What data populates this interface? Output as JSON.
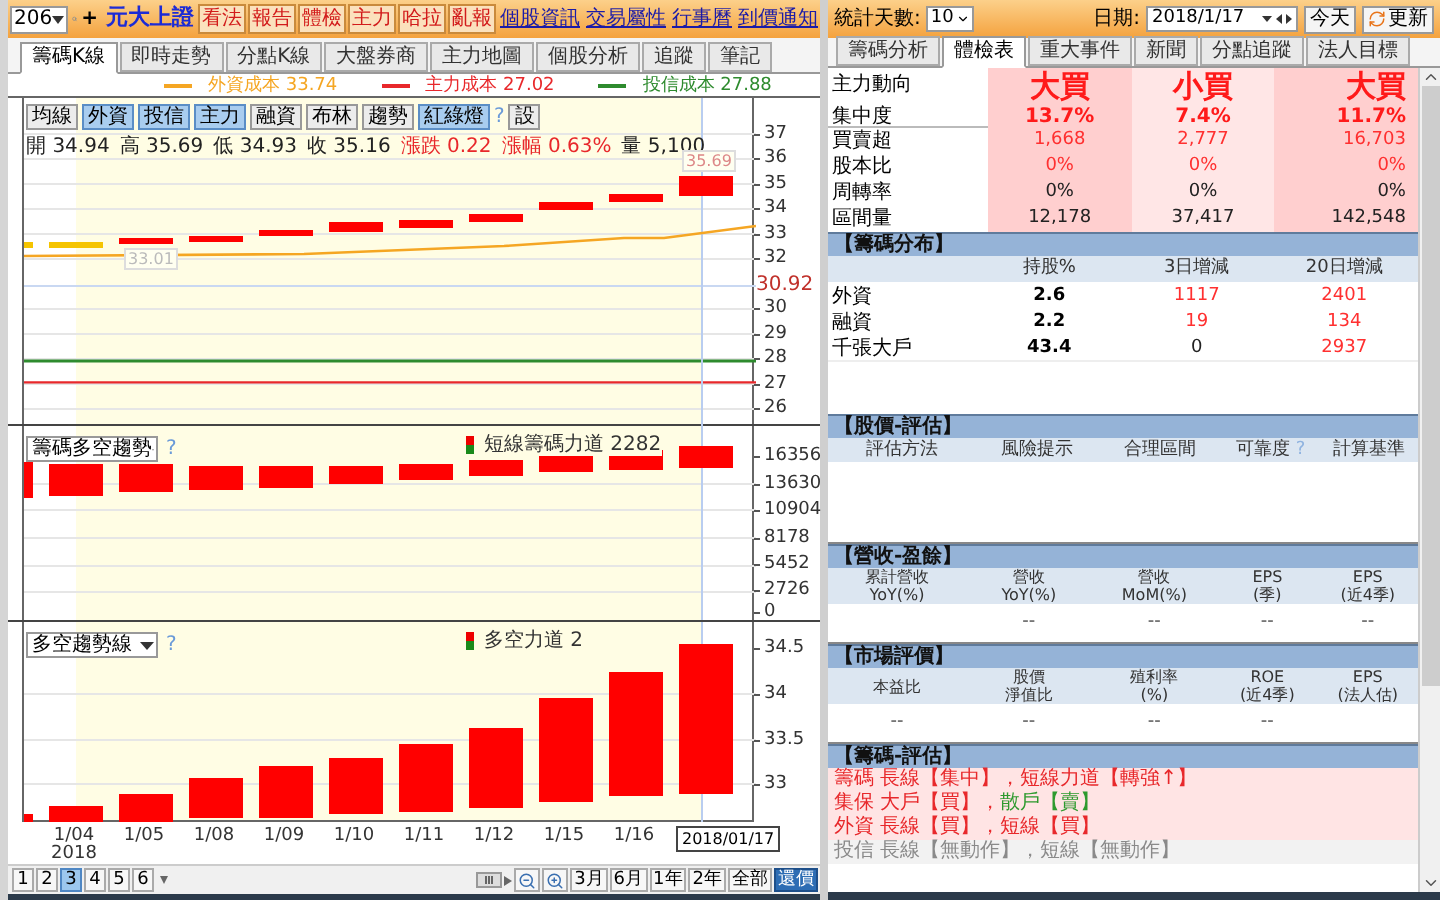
{
  "toolbar": {
    "stock_code": "206",
    "add_button": "+",
    "title": "元大上證",
    "buttons": [
      "看法",
      "報告",
      "體檢",
      "主力",
      "哈拉",
      "亂報"
    ],
    "links": [
      "個股資訊",
      "交易屬性",
      "行事曆",
      "到價通知"
    ]
  },
  "chart_tabs": [
    {
      "label": "籌碼K線",
      "selected": true
    },
    {
      "label": "即時走勢",
      "selected": false
    },
    {
      "label": "分點K線",
      "selected": false
    },
    {
      "label": "大盤券商",
      "selected": false
    },
    {
      "label": "主力地圖",
      "selected": false
    },
    {
      "label": "個股分析",
      "selected": false
    },
    {
      "label": "追蹤",
      "selected": false
    },
    {
      "label": "筆記",
      "selected": false
    }
  ],
  "legend": [
    {
      "label": "外資成本 33.74",
      "color": "#f5a623"
    },
    {
      "label": "主力成本 27.02",
      "color": "#e8282b"
    },
    {
      "label": "投信成本 27.88",
      "color": "#2e8b2e"
    }
  ],
  "indicator_buttons": [
    {
      "label": "均線",
      "selected": false
    },
    {
      "label": "外資",
      "selected": true
    },
    {
      "label": "投信",
      "selected": true
    },
    {
      "label": "主力",
      "selected": true
    },
    {
      "label": "融資",
      "selected": false
    },
    {
      "label": "布林",
      "selected": false
    },
    {
      "label": "趨勢",
      "selected": false
    },
    {
      "label": "紅綠燈",
      "selected": true
    }
  ],
  "help_mark": "?",
  "settings_button": "設",
  "quote": [
    {
      "label": "開",
      "value": "34.94",
      "kind": "price"
    },
    {
      "label": "高",
      "value": "35.69",
      "kind": "price"
    },
    {
      "label": "低",
      "value": "34.93",
      "kind": "price"
    },
    {
      "label": "收",
      "value": "35.16",
      "kind": "price"
    },
    {
      "label": "漲跌",
      "value": "0.22",
      "kind": "change"
    },
    {
      "label": "漲幅",
      "value": "0.63%",
      "kind": "change"
    },
    {
      "label": "量",
      "value": "5,100",
      "kind": "price"
    }
  ],
  "price_chart": {
    "axis": [
      "37",
      "36",
      "35",
      "34",
      "33",
      "32",
      "30",
      "29",
      "28",
      "27",
      "26"
    ],
    "last_price": "30.92",
    "markers": [
      "35.69",
      "33.01"
    ]
  },
  "flow_chart": {
    "selector": "籌碼多空趨勢",
    "help_mark": "?",
    "legend": "短線籌碼力道 2282",
    "axis": [
      "16356",
      "13630",
      "10904",
      "8178",
      "5452",
      "2726",
      "0"
    ]
  },
  "trend_chart": {
    "selector": "多空趨勢線",
    "help_mark": "?",
    "legend": "多空力道 2",
    "axis": [
      "34.5",
      "34",
      "33.5",
      "33"
    ]
  },
  "x_axis": [
    {
      "label": "1/04",
      "year": "2018",
      "kind": "date"
    },
    {
      "label": "1/05",
      "kind": "date"
    },
    {
      "label": "1/08",
      "kind": "date"
    },
    {
      "label": "1/09",
      "kind": "date"
    },
    {
      "label": "1/10",
      "kind": "date"
    },
    {
      "label": "1/11",
      "kind": "date"
    },
    {
      "label": "1/12",
      "kind": "date"
    },
    {
      "label": "1/15",
      "kind": "date"
    },
    {
      "label": "1/16",
      "kind": "date"
    },
    {
      "label": "2018/01/17",
      "kind": "cursor"
    }
  ],
  "pager": {
    "pages": [
      {
        "label": "1",
        "selected": false
      },
      {
        "label": "2",
        "selected": false
      },
      {
        "label": "3",
        "selected": true
      },
      {
        "label": "4",
        "selected": false
      },
      {
        "label": "5",
        "selected": false
      },
      {
        "label": "6",
        "selected": false
      }
    ],
    "ranges": [
      {
        "label": "3月",
        "selected": false
      },
      {
        "label": "6月",
        "selected": false
      },
      {
        "label": "1年",
        "selected": false
      },
      {
        "label": "2年",
        "selected": false
      },
      {
        "label": "全部",
        "selected": false
      },
      {
        "label": "還價",
        "selected": true
      }
    ]
  },
  "right_toolbar": {
    "days_label": "統計天數:",
    "days_value": "10",
    "date_label": "日期:",
    "date_value": "2018/1/17",
    "today_button": "今天",
    "refresh_button": "更新"
  },
  "right_tabs": [
    {
      "label": "籌碼分析",
      "selected": false
    },
    {
      "label": "體檢表",
      "selected": true
    },
    {
      "label": "重大事件",
      "selected": false
    },
    {
      "label": "新聞",
      "selected": false
    },
    {
      "label": "分點追蹤",
      "selected": false
    },
    {
      "label": "法人目標",
      "selected": false
    }
  ],
  "summary_rows": [
    {
      "label": "主力動向",
      "kind": "headline",
      "values": [
        "大買",
        "小買",
        "大買"
      ]
    },
    {
      "label": "集中度",
      "kind": "strong",
      "values": [
        "13.7%",
        "7.4%",
        "11.7%"
      ]
    },
    {
      "label": "買賣超",
      "kind": "red",
      "values": [
        "1,668",
        "2,777",
        "16,703"
      ]
    },
    {
      "label": "股本比",
      "kind": "red",
      "values": [
        "0%",
        "0%",
        "0%"
      ]
    },
    {
      "label": "周轉率",
      "kind": "plain",
      "values": [
        "0%",
        "0%",
        "0%"
      ]
    },
    {
      "label": "區間量",
      "kind": "plain",
      "values": [
        "12,178",
        "37,417",
        "142,548"
      ]
    }
  ],
  "chip_distribution": {
    "title": "【籌碼分布】",
    "columns": [
      "持股%",
      "3日增減",
      "20日增減"
    ],
    "rows": [
      {
        "label": "外資",
        "holding": "2.6",
        "change_3d": {
          "text": "1117",
          "up": true
        },
        "change_20d": {
          "text": "2401",
          "up": true
        }
      },
      {
        "label": "融資",
        "holding": "2.2",
        "change_3d": {
          "text": "19",
          "up": true
        },
        "change_20d": {
          "text": "134",
          "up": true
        }
      },
      {
        "label": "千張大戶",
        "holding": "43.4",
        "change_3d": {
          "text": "0",
          "up": false
        },
        "change_20d": {
          "text": "2937",
          "up": true
        }
      }
    ]
  },
  "valuation": {
    "title": "【股價-評估】",
    "columns": [
      "評估方法",
      "風險提示",
      "合理區間",
      "可靠度",
      "計算基準"
    ],
    "help_mark": "?"
  },
  "revenue": {
    "title": "【營收-盈餘】",
    "columns": [
      {
        "lines": [
          "累計營收",
          "YoY(%)"
        ]
      },
      {
        "lines": [
          "營收",
          "YoY(%)"
        ],
        "value": "--"
      },
      {
        "lines": [
          "營收",
          "MoM(%)"
        ],
        "value": "--"
      },
      {
        "lines": [
          "EPS",
          "(季)"
        ],
        "value": "--"
      },
      {
        "lines": [
          "EPS",
          "(近4季)"
        ],
        "value": "--"
      }
    ]
  },
  "market": {
    "title": "【市場評價】",
    "columns": [
      {
        "lines": [
          "本益比"
        ],
        "value": "--"
      },
      {
        "lines": [
          "股價",
          "淨值比"
        ],
        "value": "--"
      },
      {
        "lines": [
          "殖利率",
          "(%)"
        ],
        "value": "--"
      },
      {
        "lines": [
          "ROE",
          "(近4季)"
        ],
        "value": "--"
      },
      {
        "lines": [
          "EPS",
          "(法人估)"
        ]
      }
    ]
  },
  "chip_eval": {
    "title": "【籌碼-評估】",
    "lines": [
      {
        "kind": "signal",
        "segments": [
          {
            "text": "籌碼 長線【集中】，短線力道【轉強↑】",
            "color": "#e8282b"
          }
        ]
      },
      {
        "kind": "signal",
        "segments": [
          {
            "text": "集保 大戶【買】，",
            "color": "#e8282b"
          },
          {
            "text": "散戶【賣】",
            "color": "#2e9a2e"
          }
        ]
      },
      {
        "kind": "signal",
        "segments": [
          {
            "text": "外資 長線【買】，短線【買】",
            "color": "#e8282b"
          }
        ]
      },
      {
        "kind": "neutral",
        "segments": [
          {
            "text": "投信 長線【無動作】，短線【無動作】",
            "color": "#8a8a8a"
          }
        ]
      }
    ]
  }
}
